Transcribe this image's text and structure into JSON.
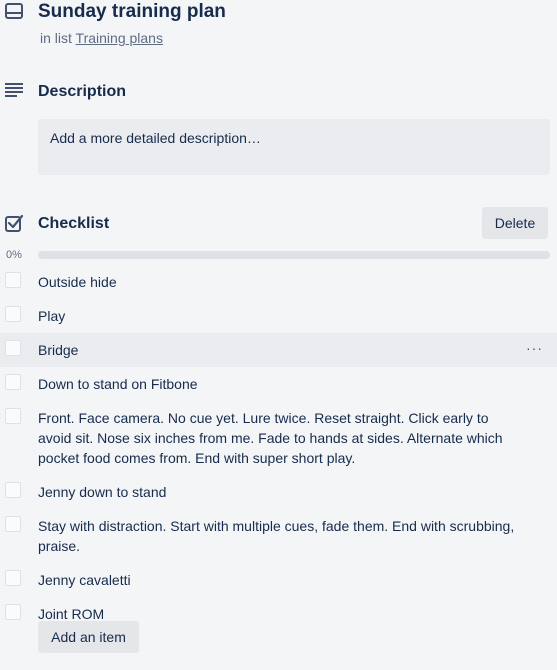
{
  "card": {
    "title": "Sunday training plan",
    "in_list_prefix": "in list",
    "list_name": "Training plans"
  },
  "description": {
    "title": "Description",
    "placeholder": "Add a more detailed description…"
  },
  "checklist": {
    "title": "Checklist",
    "delete_label": "Delete",
    "progress_label": "0%",
    "progress_fraction": 0,
    "more_label": "···",
    "items": [
      {
        "text": "Outside hide",
        "checked": false
      },
      {
        "text": "Play",
        "checked": false
      },
      {
        "text": "Bridge",
        "checked": false
      },
      {
        "text": "Down to stand on Fitbone",
        "checked": false
      },
      {
        "text": "Front. Face camera. No cue yet. Lure twice. Reset straight. Click early to avoid sit. Nose six inches from me. Fade to hands at sides. Alternate which pocket food comes from. End with super short play.",
        "checked": false
      },
      {
        "text": "Jenny down to stand",
        "checked": false
      },
      {
        "text": "Stay with distraction. Start with multiple cues, fade them. End with scrubbing, praise.",
        "checked": false
      },
      {
        "text": "Jenny cavaletti",
        "checked": false
      },
      {
        "text": "Joint ROM",
        "checked": false
      }
    ],
    "add_item_label": "Add an item"
  }
}
